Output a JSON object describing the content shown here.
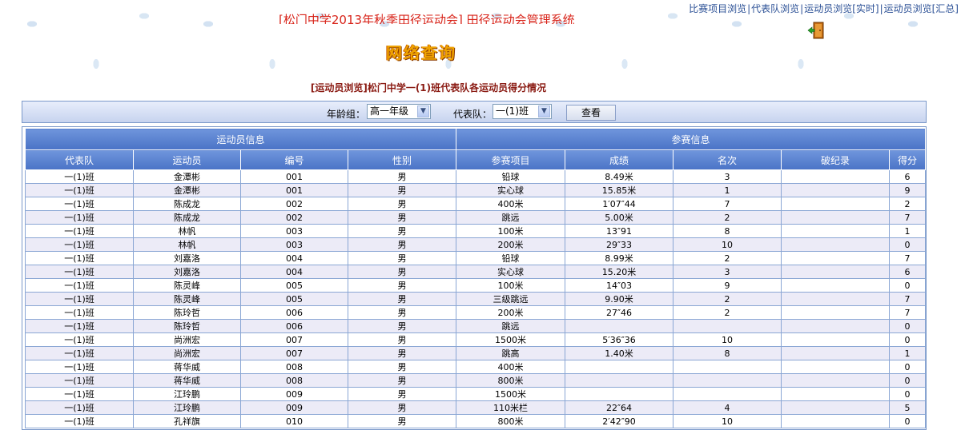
{
  "toplinks": [
    "比赛项目浏览",
    "代表队浏览",
    "运动员浏览[实时]",
    "运动员浏览[汇总]"
  ],
  "system_title": "[松门中学2013年秋季田径运动会] 田径运动会管理系统",
  "page_heading": "网络查询",
  "subtitle": "[运动员浏览]松门中学一(1)班代表队各运动员得分情况",
  "filter": {
    "grade_label": "年龄组：",
    "grade_value": "高一年级",
    "team_label": "代表队：",
    "team_value": "一(1)班",
    "query_button": "查看"
  },
  "table": {
    "group_headers": [
      "运动员信息",
      "参赛信息"
    ],
    "columns": [
      "代表队",
      "运动员",
      "编号",
      "性别",
      "参赛项目",
      "成绩",
      "名次",
      "破纪录",
      "得分"
    ],
    "rows": [
      [
        "一(1)班",
        "金潭彬",
        "001",
        "男",
        "铅球",
        "8.49米",
        "3",
        "",
        "6"
      ],
      [
        "一(1)班",
        "金潭彬",
        "001",
        "男",
        "实心球",
        "15.85米",
        "1",
        "",
        "9"
      ],
      [
        "一(1)班",
        "陈成龙",
        "002",
        "男",
        "400米",
        "1′07″44",
        "7",
        "",
        "2"
      ],
      [
        "一(1)班",
        "陈成龙",
        "002",
        "男",
        "跳远",
        "5.00米",
        "2",
        "",
        "7"
      ],
      [
        "一(1)班",
        "林帆",
        "003",
        "男",
        "100米",
        "13″91",
        "8",
        "",
        "1"
      ],
      [
        "一(1)班",
        "林帆",
        "003",
        "男",
        "200米",
        "29″33",
        "10",
        "",
        "0"
      ],
      [
        "一(1)班",
        "刘嘉洛",
        "004",
        "男",
        "铅球",
        "8.99米",
        "2",
        "",
        "7"
      ],
      [
        "一(1)班",
        "刘嘉洛",
        "004",
        "男",
        "实心球",
        "15.20米",
        "3",
        "",
        "6"
      ],
      [
        "一(1)班",
        "陈灵峰",
        "005",
        "男",
        "100米",
        "14″03",
        "9",
        "",
        "0"
      ],
      [
        "一(1)班",
        "陈灵峰",
        "005",
        "男",
        "三级跳远",
        "9.90米",
        "2",
        "",
        "7"
      ],
      [
        "一(1)班",
        "陈玲哲",
        "006",
        "男",
        "200米",
        "27″46",
        "2",
        "",
        "7"
      ],
      [
        "一(1)班",
        "陈玲哲",
        "006",
        "男",
        "跳远",
        "",
        "",
        "",
        "0"
      ],
      [
        "一(1)班",
        "尚洲宏",
        "007",
        "男",
        "1500米",
        "5′36″36",
        "10",
        "",
        "0"
      ],
      [
        "一(1)班",
        "尚洲宏",
        "007",
        "男",
        "跳高",
        "1.40米",
        "8",
        "",
        "1"
      ],
      [
        "一(1)班",
        "蒋华威",
        "008",
        "男",
        "400米",
        "",
        "",
        "",
        "0"
      ],
      [
        "一(1)班",
        "蒋华威",
        "008",
        "男",
        "800米",
        "",
        "",
        "",
        "0"
      ],
      [
        "一(1)班",
        "江玲鹏",
        "009",
        "男",
        "1500米",
        "",
        "",
        "",
        "0"
      ],
      [
        "一(1)班",
        "江玲鹏",
        "009",
        "男",
        "110米栏",
        "22″64",
        "4",
        "",
        "5"
      ],
      [
        "一(1)班",
        "孔祥旗",
        "010",
        "男",
        "800米",
        "2′42″90",
        "10",
        "",
        "0"
      ]
    ]
  }
}
